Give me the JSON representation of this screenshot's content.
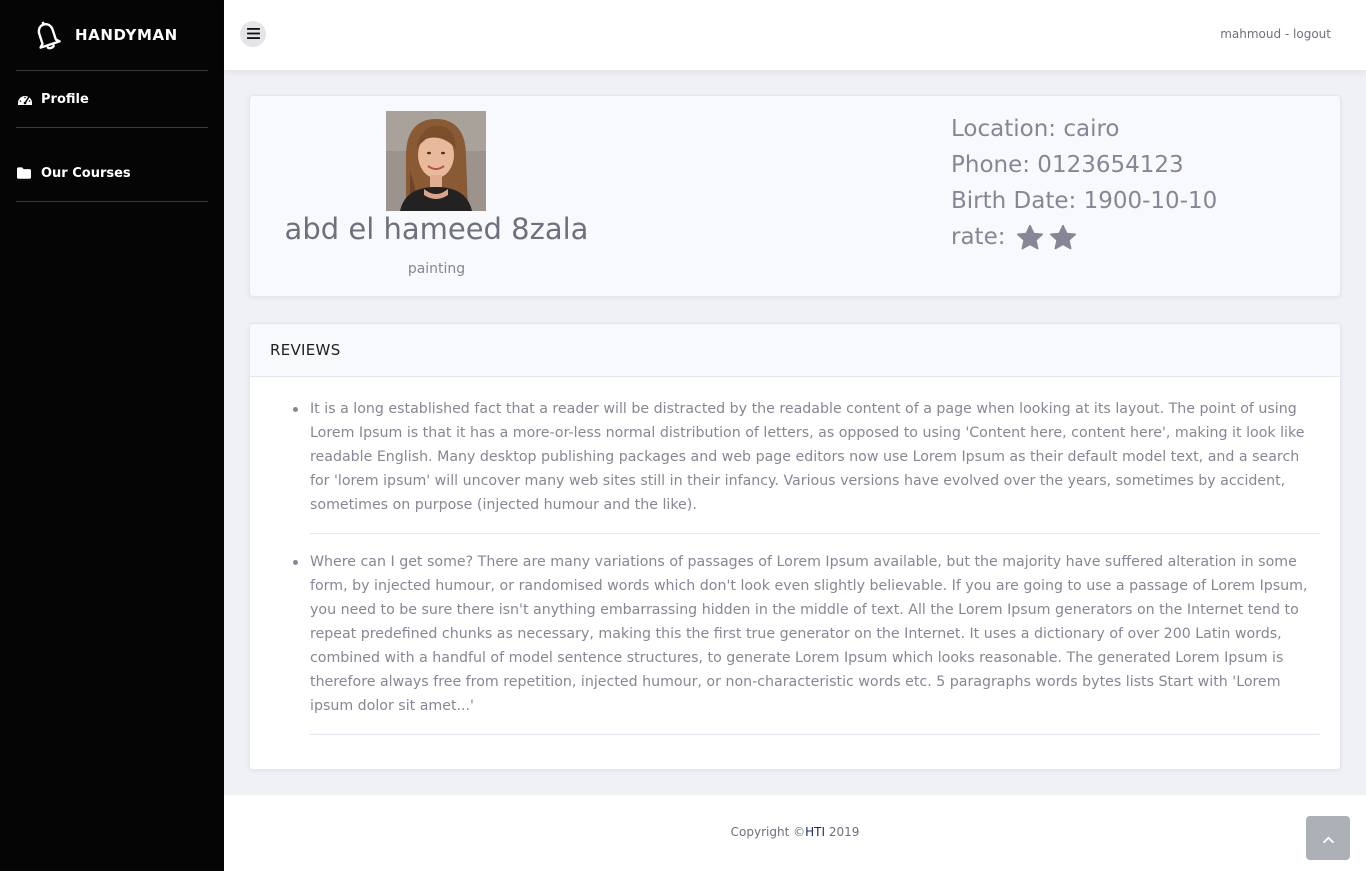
{
  "brand": {
    "name": "HANDYMAN",
    "icon": "bell-icon"
  },
  "sidebar": {
    "items": [
      {
        "label": "Profile",
        "icon": "tachometer-icon"
      },
      {
        "label": "Our Courses",
        "icon": "folder-icon"
      }
    ]
  },
  "topbar": {
    "user_link": "mahmoud - logout"
  },
  "profile": {
    "name": "abd el hameed 8zala",
    "job": "painting",
    "location": "Location: cairo",
    "phone": "Phone: 0123654123",
    "birth_date": "Birth Date: 1900-10-10",
    "rate_label": "rate:",
    "rating": 2
  },
  "reviews": {
    "title": "REVIEWS",
    "items": [
      "It is a long established fact that a reader will be distracted by the readable content of a page when looking at its layout. The point of using Lorem Ipsum is that it has a more-or-less normal distribution of letters, as opposed to using 'Content here, content here', making it look like readable English. Many desktop publishing packages and web page editors now use Lorem Ipsum as their default model text, and a search for 'lorem ipsum' will uncover many web sites still in their infancy. Various versions have evolved over the years, sometimes by accident, sometimes on purpose (injected humour and the like).",
      "Where can I get some? There are many variations of passages of Lorem Ipsum available, but the majority have suffered alteration in some form, by injected humour, or randomised words which don't look even slightly believable. If you are going to use a passage of Lorem Ipsum, you need to be sure there isn't anything embarrassing hidden in the middle of text. All the Lorem Ipsum generators on the Internet tend to repeat predefined chunks as necessary, making this the first true generator on the Internet. It uses a dictionary of over 200 Latin words, combined with a handful of model sentence structures, to generate Lorem Ipsum which looks reasonable. The generated Lorem Ipsum is therefore always free from repetition, injected humour, or non-characteristic words etc. 5 paragraphs words bytes lists Start with 'Lorem ipsum dolor sit amet...'"
    ]
  },
  "footer": {
    "copyright_prefix": "Copyright ©",
    "copyright_brand": "HTI",
    "copyright_year": " 2019"
  },
  "colors": {
    "sidebar_bg": "#050505",
    "star": "#858796",
    "text": "#858796"
  }
}
